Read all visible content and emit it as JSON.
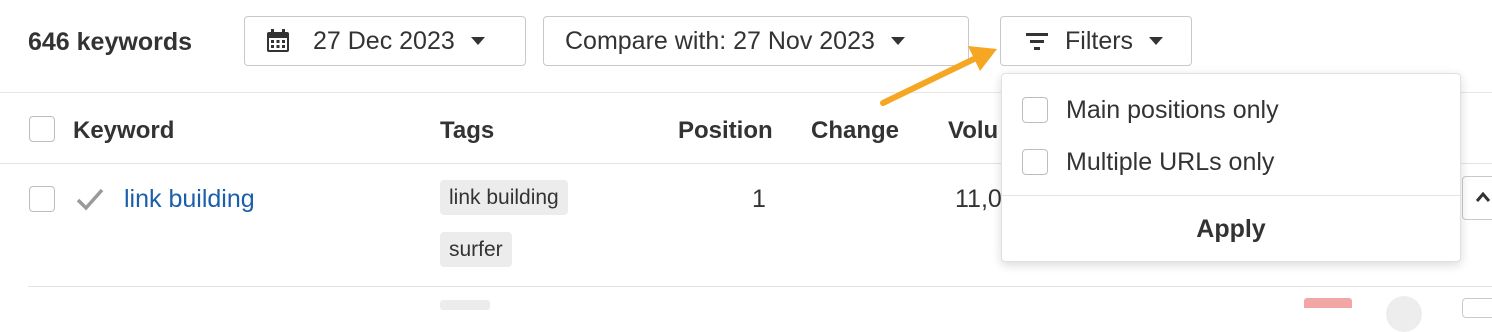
{
  "toolbar": {
    "keyword_count": "646 keywords",
    "date_label": "27 Dec 2023",
    "compare_label": "Compare with: 27 Nov 2023",
    "filters_label": "Filters"
  },
  "table": {
    "columns": {
      "keyword": "Keyword",
      "tags": "Tags",
      "position": "Position",
      "change": "Change",
      "volume": "Volu"
    },
    "rows": [
      {
        "keyword": "link building",
        "tags": [
          "link building",
          "surfer"
        ],
        "position": "1",
        "volume": "11,0"
      }
    ]
  },
  "filters_dropdown": {
    "options": [
      {
        "label": "Main positions only",
        "checked": false
      },
      {
        "label": "Multiple URLs only",
        "checked": false
      }
    ],
    "apply_label": "Apply"
  },
  "colors": {
    "link": "#1b5fa8",
    "arrow": "#f5a623",
    "tag_bg": "#ececec",
    "border": "#c9c9c9"
  },
  "icons": {
    "date_button": "calendar-icon",
    "filters_button": "filter-icon",
    "row_status": "checkmark-icon",
    "annotation": "annotation-arrow"
  }
}
